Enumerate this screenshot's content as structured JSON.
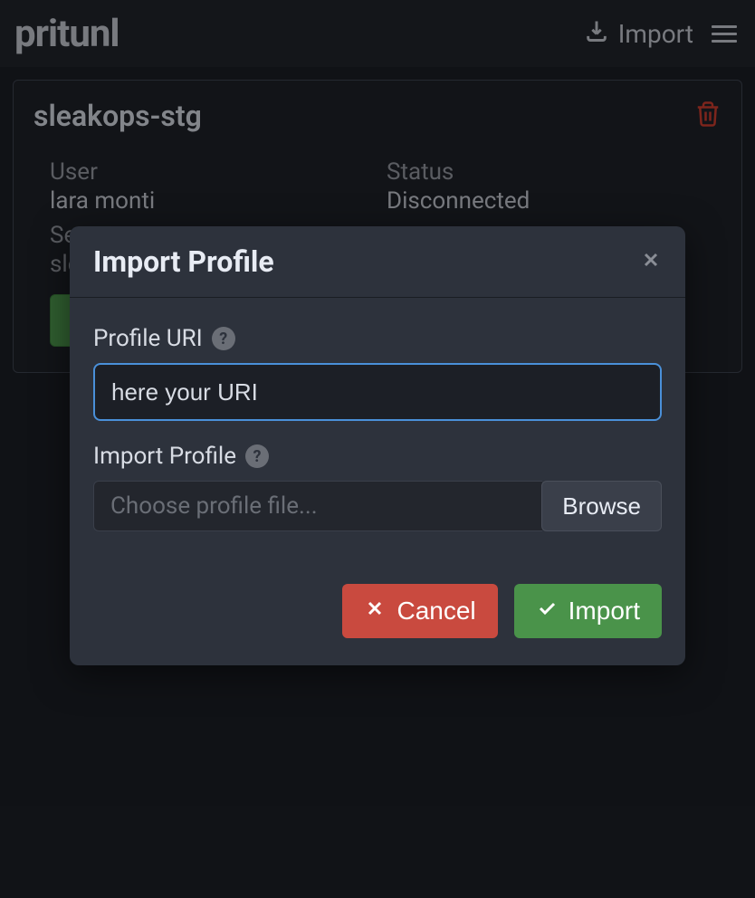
{
  "header": {
    "logo": "pritunl",
    "import_label": "Import"
  },
  "profile": {
    "name": "sleakops-stg",
    "fields": {
      "user_label": "User",
      "user_value": "lara monti",
      "status_label": "Status",
      "status_value": "Disconnected",
      "server_label_partial": "Se",
      "server_value_partial": "sle"
    }
  },
  "modal": {
    "title": "Import Profile",
    "profile_uri_label": "Profile URI",
    "profile_uri_value": "here your URI",
    "import_profile_label": "Import Profile",
    "file_placeholder": "Choose profile file...",
    "browse_label": "Browse",
    "cancel_label": "Cancel",
    "import_label": "Import"
  }
}
